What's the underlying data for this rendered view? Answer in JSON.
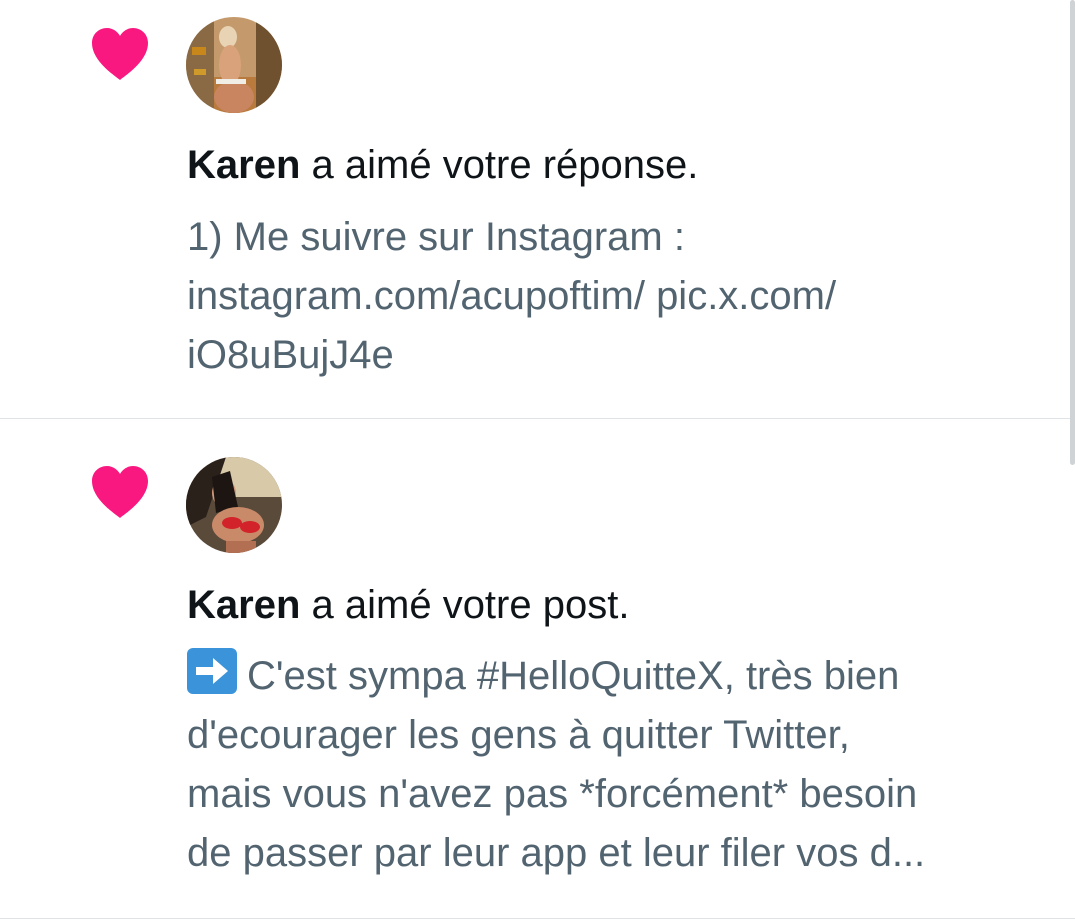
{
  "colors": {
    "heart": "#f91880",
    "primary_text": "#0f1419",
    "secondary_text": "#536471",
    "divider": "#dfe3e6"
  },
  "notifications": [
    {
      "icon": "heart-icon",
      "user_name": "Karen",
      "action_text": "a aimé votre réponse.",
      "snippet": "1) Me suivre sur Instagram :\ninstagram.com/acupoftim/ pic.x.com/\niO8uBujJ4e"
    },
    {
      "icon": "heart-icon",
      "user_name": "Karen",
      "action_text": "a aimé votre post.",
      "snippet_emoji": "right-arrow-emoji",
      "snippet": "C'est sympa #HelloQuitteX, très bien\nd'ecourager les gens à quitter Twitter,\nmais vous n'avez pas *forcément* besoin\nde passer par leur app et leur filer vos d..."
    }
  ]
}
